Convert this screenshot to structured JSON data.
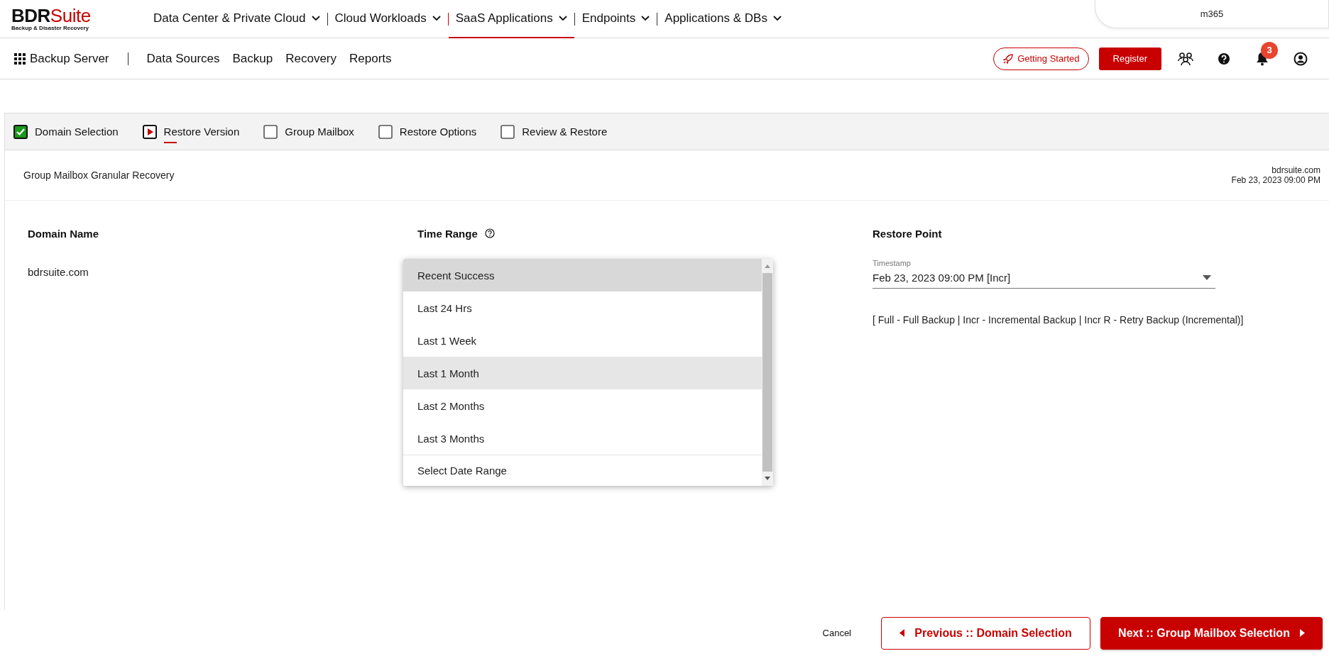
{
  "logo": {
    "brand_dark": "BDR",
    "brand_red": "Suite",
    "tagline": "Backup & Disaster Recovery"
  },
  "top_nav": [
    {
      "label": "Data Center & Private Cloud",
      "selected": false
    },
    {
      "label": "Cloud Workloads",
      "selected": false
    },
    {
      "label": "SaaS Applications",
      "selected": true
    },
    {
      "label": "Endpoints",
      "selected": false
    },
    {
      "label": "Applications & DBs",
      "selected": false
    }
  ],
  "account_tab": "m365",
  "sub_nav": {
    "title": "Backup Server",
    "links": [
      "Data Sources",
      "Backup",
      "Recovery",
      "Reports"
    ]
  },
  "actions": {
    "getting_started": "Getting Started",
    "register": "Register",
    "notification_count": "3"
  },
  "steps": [
    {
      "label": "Domain Selection",
      "kind": "done"
    },
    {
      "label": "Restore Version",
      "kind": "current"
    },
    {
      "label": "Group Mailbox",
      "kind": "pending"
    },
    {
      "label": "Restore Options",
      "kind": "pending"
    },
    {
      "label": "Review & Restore",
      "kind": "pending"
    }
  ],
  "page": {
    "title": "Group Mailbox Granular Recovery",
    "domain": "bdrsuite.com",
    "timestamp": "Feb 23, 2023 09:00 PM"
  },
  "domain": {
    "heading": "Domain Name",
    "value": "bdrsuite.com"
  },
  "time_range": {
    "heading": "Time Range",
    "options": [
      {
        "label": "Recent Success",
        "selected": true,
        "hovered": false
      },
      {
        "label": "Last 24 Hrs",
        "selected": false,
        "hovered": false
      },
      {
        "label": "Last 1 Week",
        "selected": false,
        "hovered": false
      },
      {
        "label": "Last 1 Month",
        "selected": false,
        "hovered": true
      },
      {
        "label": "Last 2 Months",
        "selected": false,
        "hovered": false
      },
      {
        "label": "Last 3 Months",
        "selected": false,
        "hovered": false
      },
      {
        "label": "Select Date Range",
        "selected": false,
        "hovered": false
      }
    ]
  },
  "restore_point": {
    "heading": "Restore Point",
    "field_label": "Timestamp",
    "value": "Feb 23, 2023 09:00 PM [Incr]",
    "legend": "[ Full - Full Backup | Incr - Incremental Backup | Incr R - Retry Backup (Incremental)]"
  },
  "footer": {
    "cancel": "Cancel",
    "previous": "Previous :: Domain Selection",
    "next": "Next :: Group Mailbox Selection"
  }
}
